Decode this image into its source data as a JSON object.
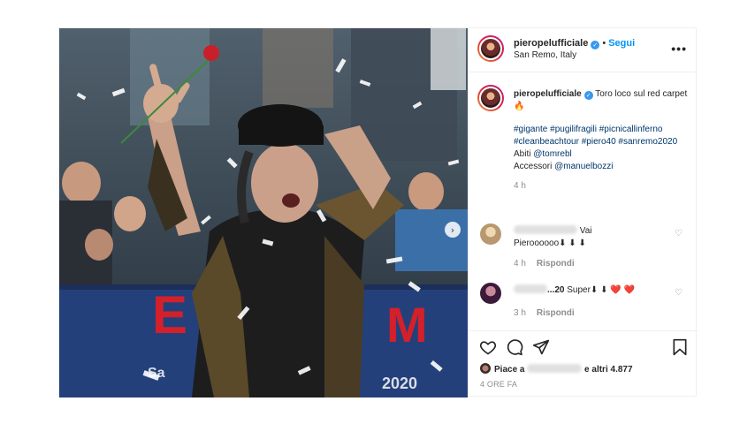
{
  "post": {
    "username": "pieropelufficiale",
    "verified_mark": "✓",
    "separator": "•",
    "follow_label": "Segui",
    "location": "San Remo, Italy",
    "more_label": "•••",
    "next_label": "›"
  },
  "caption": {
    "username": "pieropelufficiale",
    "text": "Toro loco sul red carpet🔥",
    "hashtags": "#gigante #pugilifragili #picnicallinferno #cleanbeachtour #piero40 #sanremo2020",
    "credits_1_prefix": "Abiti ",
    "credits_1_link": "@tomrebl",
    "credits_2_prefix": "Accessori ",
    "credits_2_link": "@manuelbozzi",
    "time": "4 h"
  },
  "comments": [
    {
      "text_suffix": " Vai",
      "text_line2": "Pieroooooo⬇ ⬇ ⬇",
      "time": "4 h",
      "reply_label": "Rispondi",
      "like_icon": "♡"
    },
    {
      "username_visible": "...20",
      "text": " Super⬇ ⬇ ❤️ ❤️",
      "time": "3 h",
      "reply_label": "Rispondi",
      "like_icon": "♡"
    }
  ],
  "actions": {
    "icons": [
      "heart-icon",
      "comment-icon",
      "share-icon",
      "bookmark-icon"
    ],
    "likes_prefix": "Piace a",
    "likes_suffix": "e altri 4.877",
    "post_time": "4 ORE FA"
  },
  "colors": {
    "link": "#00376b",
    "follow": "#0095f6",
    "verified": "#3897f0",
    "muted": "#8e8e8e"
  }
}
